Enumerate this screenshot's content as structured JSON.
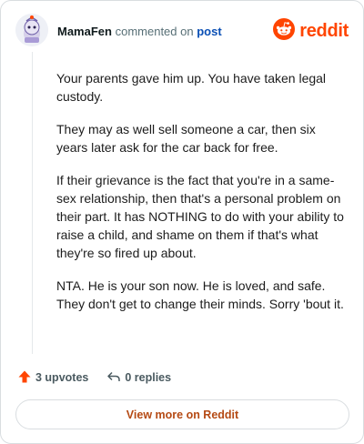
{
  "header": {
    "username": "MamaFen",
    "action_text": "commented on",
    "post_link": "post",
    "brand": "reddit",
    "avatar_icon": "snoo-avatar-icon",
    "brand_icon": "reddit-logo-icon"
  },
  "comment": {
    "paragraphs": [
      "Your parents gave him up. You have taken legal custody.",
      "They may as well sell someone a car, then six years later ask for the car back for free.",
      "If their grievance is the fact that you're in a same-sex relationship, then that's a personal problem on their part. It has NOTHING to do with your ability to raise a child, and shame on them if that's what they're so fired up about.",
      "NTA. He is your son now. He is loved, and safe. They don't get to change their minds. Sorry 'bout it."
    ]
  },
  "actions": {
    "upvotes_label": "3 upvotes",
    "replies_label": "0 replies",
    "upvote_icon": "upvote-arrow-icon",
    "reply_icon": "reply-arrow-icon"
  },
  "footer": {
    "view_more_label": "View more on Reddit"
  },
  "colors": {
    "brand": "#ff4500",
    "link": "#0a4fb5",
    "cta_text": "#b54a14"
  }
}
